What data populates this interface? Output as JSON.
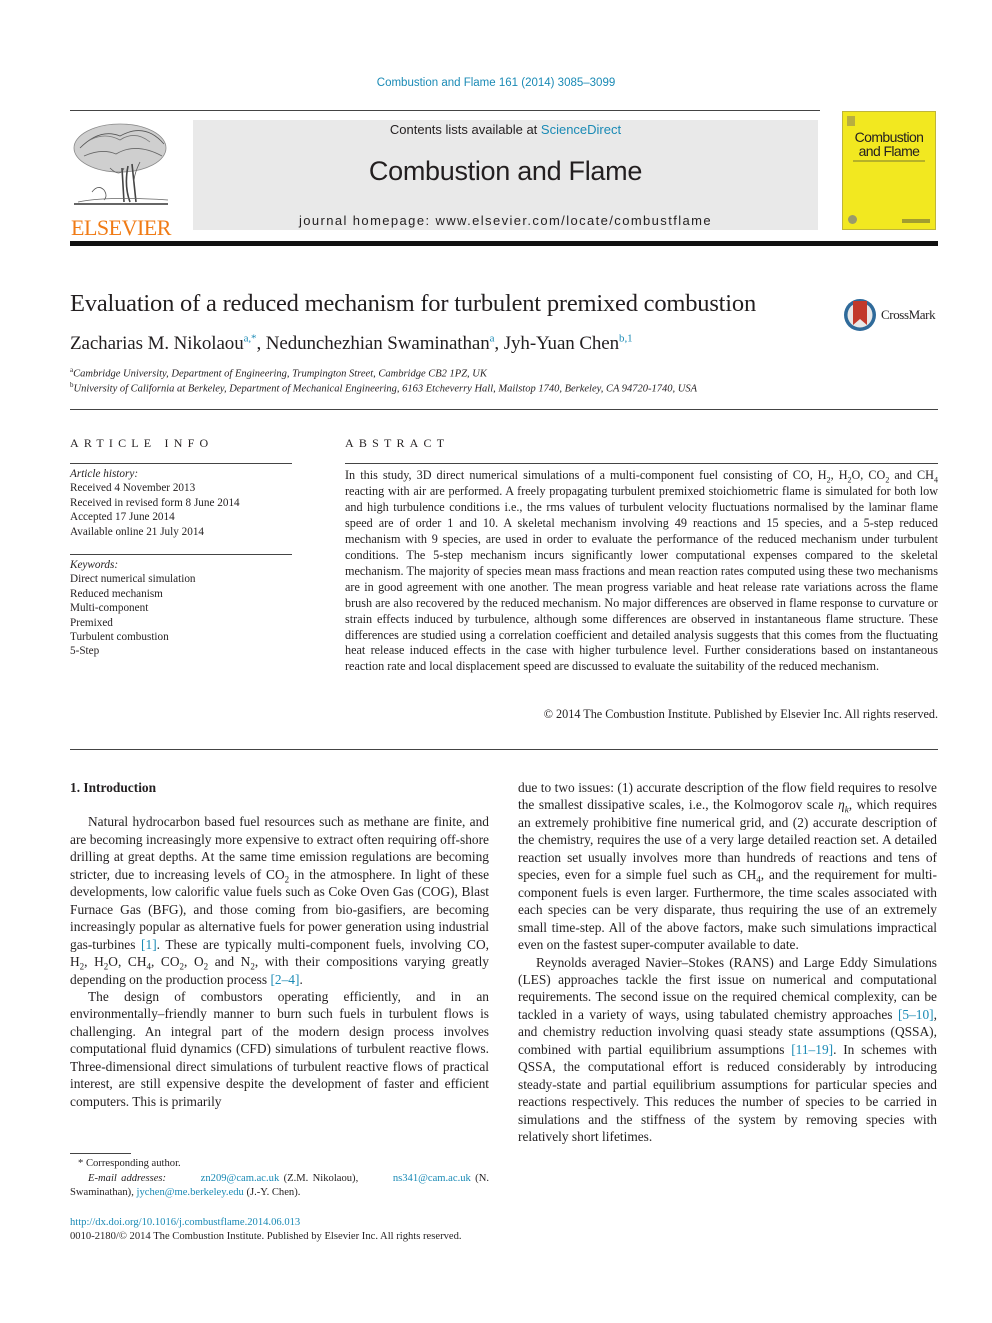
{
  "header": {
    "running_head": "Combustion and Flame 161 (2014) 3085–3099",
    "contents_prefix": "Contents lists available at ",
    "contents_link": "ScienceDirect",
    "journal_title": "Combustion and Flame",
    "homepage": "journal homepage: www.elsevier.com/locate/combustflame",
    "publisher_logo_text": "ELSEVIER",
    "cover_title_line1": "Combustion",
    "cover_title_line2": "and Flame",
    "crossmark_label": "CrossMark"
  },
  "colors": {
    "link": "#1a8ab5",
    "elsevier_orange": "#f07b15",
    "cover_yellow": "#f2e820",
    "band_gray": "#e9e9e9"
  },
  "article": {
    "title": "Evaluation of a reduced mechanism for turbulent premixed combustion",
    "authors": [
      {
        "name": "Zacharias M. Nikolaou",
        "sup": "a,*",
        "sep": ", "
      },
      {
        "name": "Nedunchezhian Swaminathan",
        "sup": "a",
        "sep": ", "
      },
      {
        "name": "Jyh-Yuan Chen",
        "sup": "b,1",
        "sep": ""
      }
    ],
    "affiliations": [
      {
        "mark": "a",
        "text": "Cambridge University, Department of Engineering, Trumpington Street, Cambridge CB2 1PZ, UK"
      },
      {
        "mark": "b",
        "text": "University of California at Berkeley, Department of Mechanical Engineering, 6163 Etcheverry Hall, Mailstop 1740, Berkeley, CA 94720-1740, USA"
      }
    ]
  },
  "article_info": {
    "heading": "ARTICLE INFO",
    "history_label": "Article history:",
    "history": [
      "Received 4 November 2013",
      "Received in revised form 8 June 2014",
      "Accepted 17 June 2014",
      "Available online 21 July 2014"
    ],
    "keywords_label": "Keywords:",
    "keywords": [
      "Direct numerical simulation",
      "Reduced mechanism",
      "Multi-component",
      "Premixed",
      "Turbulent combustion",
      "5-Step"
    ]
  },
  "abstract": {
    "heading": "ABSTRACT",
    "p1a": "In this study, 3D direct numerical simulations of a multi-component fuel consisting of CO, H",
    "p1b": ", H",
    "p1c": "O, CO",
    "p1d": " and CH",
    "p1e": " reacting with air are performed. A freely propagating turbulent premixed stoichiometric flame is simulated for both low and high turbulence conditions i.e., the rms values of turbulent velocity fluctuations normalised by the laminar flame speed are of order 1 and 10. A skeletal mechanism involving 49 reactions and 15 species, and a 5-step reduced mechanism with 9 species, are used in order to evaluate the performance of the reduced mechanism under turbulent conditions. The 5-step mechanism incurs significantly lower computational expenses compared to the skeletal mechanism. The majority of species mean mass fractions and mean reaction rates computed using these two mechanisms are in good agreement with one another. The mean progress variable and heat release rate variations across the flame brush are also recovered by the reduced mechanism. No major differences are observed in flame response to curvature or strain effects induced by turbulence, although some differences are observed in instantaneous flame structure. These differences are studied using a correlation coefficient and detailed analysis suggests that this comes from the fluctuating heat release induced effects in the case with higher turbulence level. Further considerations based on instantaneous reaction rate and local displacement speed are discussed to evaluate the suitability of the reduced mechanism.",
    "copyright": "© 2014 The Combustion Institute. Published by Elsevier Inc. All rights reserved."
  },
  "body": {
    "section_heading": "1. Introduction",
    "left": {
      "p1a": "Natural hydrocarbon based fuel resources such as methane are finite, and are becoming increasingly more expensive to extract often requiring off-shore drilling at great depths. At the same time emission regulations are becoming stricter, due to increasing levels of CO",
      "p1b": " in the atmosphere. In light of these developments, low calorific value fuels such as Coke Oven Gas (COG), Blast Furnace Gas (BFG), and those coming from bio-gasifiers, are becoming increasingly popular as alternative fuels for power generation using industrial gas-turbines ",
      "ref1": "[1]",
      "p1c": ". These are typically multi-component fuels, involving CO, H",
      "p1d": ", H",
      "p1e": "O, CH",
      "p1f": ", CO",
      "p1g": ", O",
      "p1h": " and N",
      "p1i": ", with their compositions varying greatly depending on the production process ",
      "ref2": "[2–4]",
      "p1j": ".",
      "p2": "The design of combustors operating efficiently, and in an environmentally–friendly manner to burn such fuels in turbulent flows is challenging. An integral part of the modern design process involves computational fluid dynamics (CFD) simulations of turbulent reactive flows. Three-dimensional direct simulations of turbulent reactive flows of practical interest, are still expensive despite the development of faster and efficient computers. This is primarily"
    },
    "right": {
      "p1a": "due to two issues: (1) accurate description of the flow field requires to resolve the smallest dissipative scales, i.e., the Kolmogorov scale ",
      "eta": "η",
      "eta_sub": "k",
      "p1b": ", which requires an extremely prohibitive fine numerical grid, and (2) accurate description of the chemistry, requires the use of a very large detailed reaction set. A detailed reaction set usually involves more than hundreds of reactions and tens of species, even for a simple fuel such as CH",
      "p1c": ", and the requirement for multi-component fuels is even larger. Furthermore, the time scales associated with each species can be very disparate, thus requiring the use of an extremely small time-step. All of the above factors, make such simulations impractical even on the fastest super-computer available to date.",
      "p2a": "Reynolds averaged Navier–Stokes (RANS) and Large Eddy Simulations (LES) approaches tackle the first issue on numerical and computational requirements. The second issue on the required chemical complexity, can be tackled in a variety of ways, using tabulated chemistry approaches ",
      "ref3": "[5–10]",
      "p2b": ", and chemistry reduction involving quasi steady state assumptions (QSSA), combined with partial equilibrium assumptions ",
      "ref4": "[11–19]",
      "p2c": ". In schemes with QSSA, the computational effort is reduced considerably by introducing steady-state and partial equilibrium assumptions for particular species and reactions respectively. This reduces the number of species to be carried in simulations and the stiffness of the system by removing species with relatively short lifetimes."
    },
    "subscripts": {
      "two": "2",
      "four": "4"
    }
  },
  "footnotes": {
    "corresponding": "* Corresponding author.",
    "email_label": "E-mail addresses:",
    "email1": "zn209@cam.ac.uk",
    "email1_owner": " (Z.M. Nikolaou), ",
    "email2": "ns341@cam.ac.uk",
    "email2_owner": " (N. Swaminathan), ",
    "email3": "jychen@me.berkeley.edu",
    "email3_owner": " (J.-Y. Chen)."
  },
  "footer": {
    "doi": "http://dx.doi.org/10.1016/j.combustflame.2014.06.013",
    "issn": "0010-2180/© 2014 The Combustion Institute. Published by Elsevier Inc. All rights reserved."
  }
}
